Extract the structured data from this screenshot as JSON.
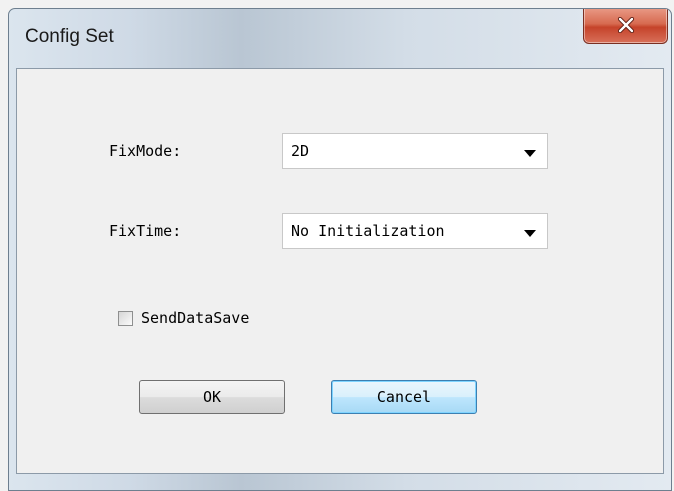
{
  "window": {
    "title": "Config Set",
    "close_icon": "close-icon"
  },
  "form": {
    "fixmode": {
      "label": "FixMode:",
      "selected": "2D"
    },
    "fixtime": {
      "label": "FixTime:",
      "selected": "No Initialization"
    },
    "senddatasave": {
      "label": "SendDataSave",
      "checked": false
    }
  },
  "buttons": {
    "ok": "OK",
    "cancel": "Cancel"
  }
}
